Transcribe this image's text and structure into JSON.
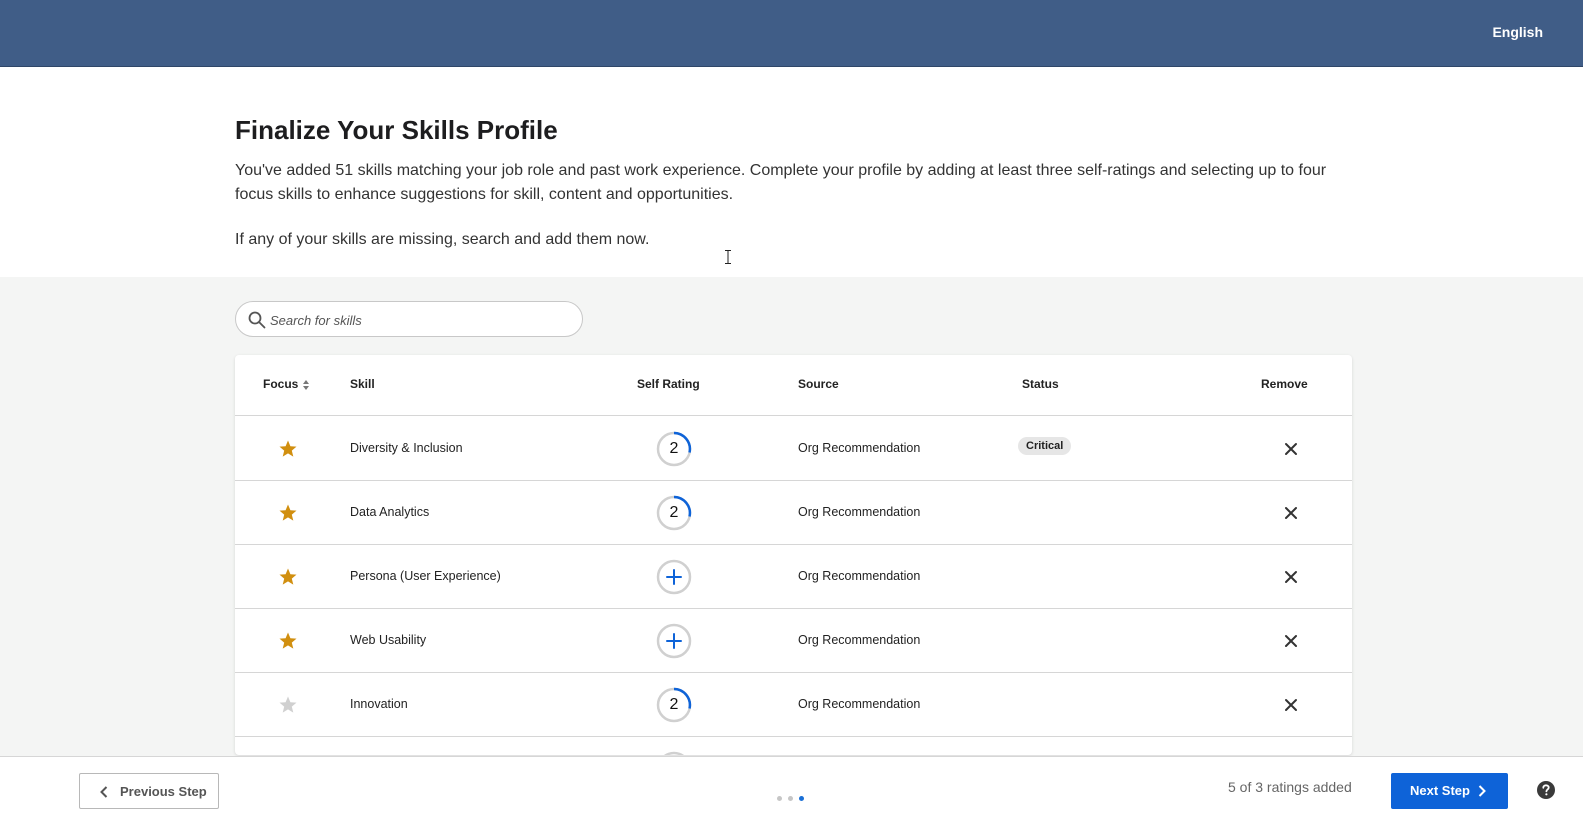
{
  "header": {
    "language": "English",
    "brand_color": "#405d87"
  },
  "intro": {
    "title": "Finalize Your Skills Profile",
    "description": "You've added 51 skills matching your job role and past work experience. Complete your profile by adding at least three self-ratings and selecting up to four focus skills to enhance suggestions for skill, content and opportunities.",
    "missing_note": "If any of your skills are missing, search and add them now."
  },
  "search": {
    "placeholder": "Search for skills",
    "icon": "search-icon"
  },
  "table": {
    "columns": {
      "focus": "Focus",
      "skill": "Skill",
      "self_rating": "Self Rating",
      "source": "Source",
      "status": "Status",
      "remove": "Remove"
    },
    "rows": [
      {
        "focus": true,
        "skill": "Diversity & Inclusion",
        "rating": "2",
        "source": "Org Recommendation",
        "status": "Critical"
      },
      {
        "focus": true,
        "skill": "Data Analytics",
        "rating": "2",
        "source": "Org Recommendation",
        "status": ""
      },
      {
        "focus": true,
        "skill": "Persona (User Experience)",
        "rating": "",
        "source": "Org Recommendation",
        "status": ""
      },
      {
        "focus": true,
        "skill": "Web Usability",
        "rating": "",
        "source": "Org Recommendation",
        "status": ""
      },
      {
        "focus": false,
        "skill": "Innovation",
        "rating": "2",
        "source": "Org Recommendation",
        "status": ""
      }
    ]
  },
  "footer": {
    "previous_label": "Previous Step",
    "next_label": "Next Step",
    "ratings_status": "5 of 3 ratings added",
    "step_total": 3,
    "step_current": 3,
    "accent_color": "#0e63d8",
    "focus_star_color": "#d18f0f"
  }
}
